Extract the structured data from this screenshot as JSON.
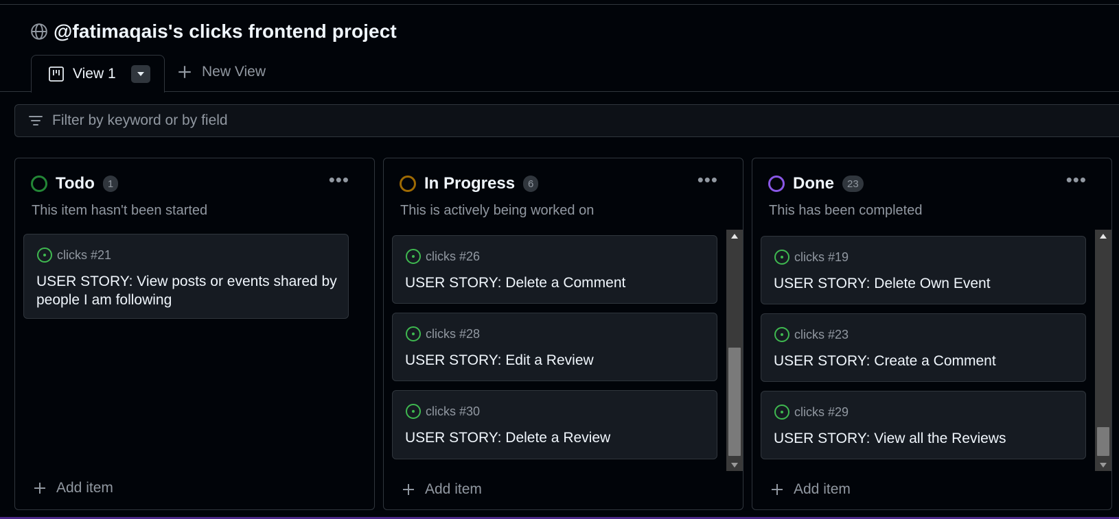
{
  "project": {
    "title": "@fatimaqais's clicks frontend project",
    "icon": "globe-icon"
  },
  "tabs": {
    "active_label": "View 1",
    "new_view_label": "New View"
  },
  "filter": {
    "placeholder": "Filter by keyword or by field"
  },
  "columns": [
    {
      "title": "Todo",
      "count": "1",
      "description": "This item hasn't been started",
      "status_color": "#238636",
      "cards": [
        {
          "ref": "clicks #21",
          "title": "USER STORY: View posts or events shared by people I am following"
        }
      ],
      "add_label": "Add item"
    },
    {
      "title": "In Progress",
      "count": "6",
      "description": "This is actively being worked on",
      "status_color": "#9e6a03",
      "cards": [
        {
          "ref": "clicks #26",
          "title": "USER STORY: Delete a Comment"
        },
        {
          "ref": "clicks #28",
          "title": "USER STORY: Edit a Review"
        },
        {
          "ref": "clicks #30",
          "title": "USER STORY: Delete a Review"
        }
      ],
      "add_label": "Add item"
    },
    {
      "title": "Done",
      "count": "23",
      "description": "This has been completed",
      "status_color": "#8957e5",
      "cards": [
        {
          "ref": "clicks #19",
          "title": "USER STORY: Delete Own Event"
        },
        {
          "ref": "clicks #23",
          "title": "USER STORY: Create a Comment"
        },
        {
          "ref": "clicks #29",
          "title": "USER STORY: View all the Reviews"
        }
      ],
      "add_label": "Add item"
    }
  ],
  "colors": {
    "issue_open": "#3fb950",
    "border": "#30363d",
    "card_bg": "#161b22"
  }
}
